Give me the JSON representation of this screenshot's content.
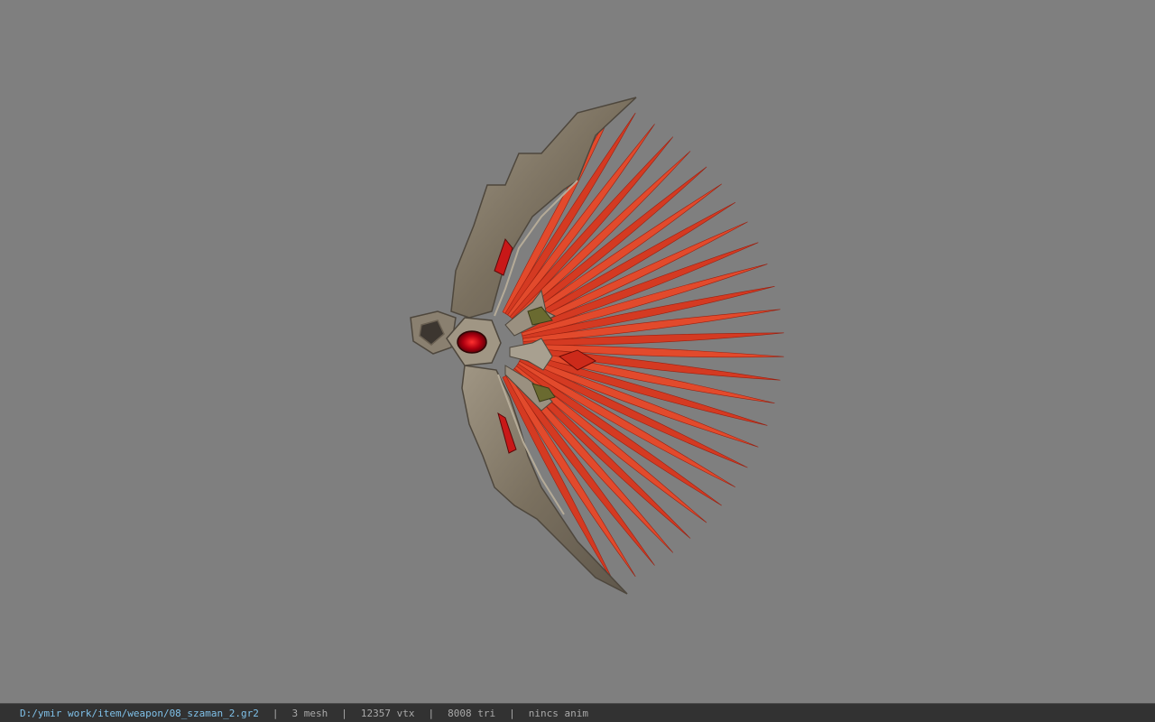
{
  "viewport": {
    "background": "#7f7f7f",
    "model": {
      "feather_color": "#d83a22",
      "frame_color": "#8a8070",
      "gem_color": "#c0101a"
    }
  },
  "status_bar": {
    "file_path": "D:/ymir work/item/weapon/08_szaman_2.gr2",
    "separator": "|",
    "mesh_count": "3 mesh",
    "vertex_count": "12357 vtx",
    "triangle_count": "8008 tri",
    "anim_status": "nincs anim"
  }
}
